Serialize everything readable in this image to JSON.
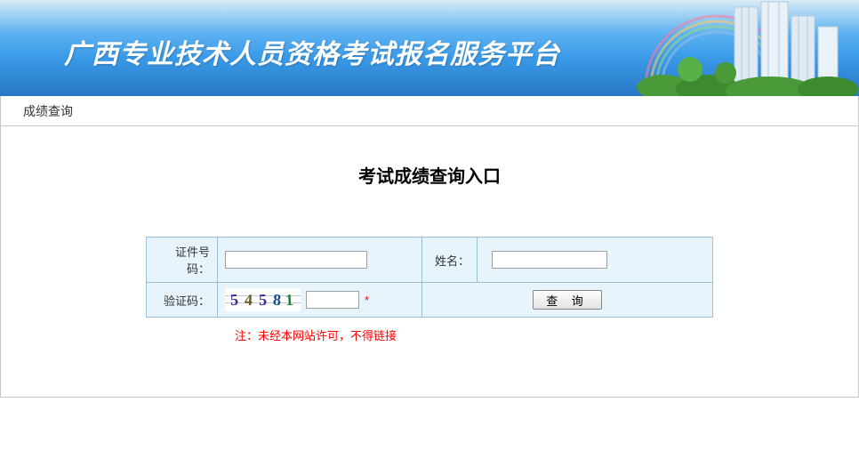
{
  "banner": {
    "title": "广西专业技术人员资格考试报名服务平台"
  },
  "nav": {
    "item1": "成绩查询"
  },
  "main": {
    "heading": "考试成绩查询入口",
    "idLabel": "证件号码：",
    "nameLabel": "姓名：",
    "captchaLabel": "验证码：",
    "captcha": {
      "c1": "5",
      "c2": "4",
      "c3": "5",
      "c4": "8",
      "c5": "1"
    },
    "requiredMark": "*",
    "submit": "查 询",
    "note": "注：未经本网站许可，不得链接"
  }
}
